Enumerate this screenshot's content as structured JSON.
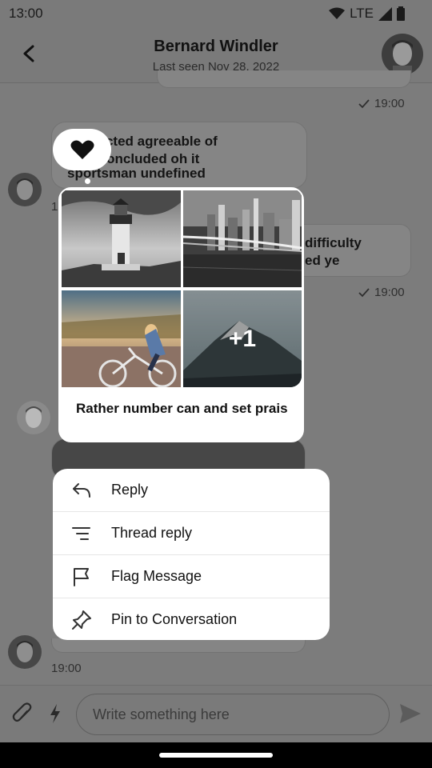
{
  "status_bar": {
    "time": "13:00",
    "network": "LTE"
  },
  "header": {
    "title": "Bernard Windler",
    "subtitle": "Last seen Nov 28, 2022"
  },
  "conversation": {
    "top_time": "19:00",
    "msg1_lines": [
      "Selected agreeable of",
      "very concluded oh it",
      "sportsman undefined"
    ],
    "msg2_line1": "difficulty",
    "msg2_line2": "ed ye",
    "msg2_time": "19:00",
    "bottom_time": "19:00",
    "side_time_fragment": "1"
  },
  "focused_message": {
    "reaction": "heart-icon",
    "more_count": "+1",
    "text": "Rather number can and set prais"
  },
  "context_menu": {
    "items": [
      {
        "label": "Reply",
        "icon": "reply-icon"
      },
      {
        "label": "Thread reply",
        "icon": "thread-icon"
      },
      {
        "label": "Flag Message",
        "icon": "flag-icon"
      },
      {
        "label": "Pin to Conversation",
        "icon": "pin-icon"
      }
    ]
  },
  "composer": {
    "placeholder": "Write something here"
  },
  "colors": {
    "scrim": "#7c7c7c",
    "surface": "#ffffff",
    "text": "#111111"
  }
}
